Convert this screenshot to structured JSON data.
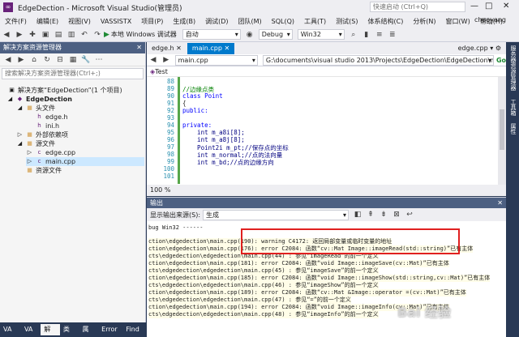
{
  "window": {
    "title": "EdgeDection - Microsoft Visual Studio(管理员)",
    "quick_launch_placeholder": "快速启动 (Ctrl+Q)",
    "user": "chaoyang"
  },
  "menu": [
    "文件(F)",
    "编辑(E)",
    "视图(V)",
    "VASSISTX",
    "项目(P)",
    "生成(B)",
    "调试(D)",
    "团队(M)",
    "SQL(Q)",
    "工具(T)",
    "测试(S)",
    "体系结构(C)",
    "分析(N)",
    "窗口(W)",
    "帮助(H)"
  ],
  "toolbar": {
    "run_label": "本地 Windows 调试器",
    "mode": "自动",
    "config": "Debug",
    "platform": "Win32"
  },
  "solution_explorer": {
    "title": "解决方案资源管理器",
    "search_placeholder": "搜索解决方案资源管理器(Ctrl+;)",
    "items": [
      {
        "label": "解决方案“EdgeDection”(1 个项目)"
      },
      {
        "label": "EdgeDection"
      },
      {
        "label": "头文件"
      },
      {
        "label": "edge.h"
      },
      {
        "label": "ini.h"
      },
      {
        "label": "外部依赖项"
      },
      {
        "label": "源文件"
      },
      {
        "label": "edge.cpp"
      },
      {
        "label": "main.cpp"
      },
      {
        "label": "资源文件"
      }
    ],
    "bottom_tabs": [
      "VA W...",
      "VA V...",
      "解决...",
      "类视图",
      "属性...",
      "Error L...",
      "Find S..."
    ]
  },
  "editor": {
    "tabs": [
      "edge.h",
      "main.cpp"
    ],
    "right_tab": "edge.cpp",
    "file_combo": "main.cpp",
    "path": "G:\\documents\\visual studio 2013\\Projects\\EdgeDection\\EdgeDection\\ma",
    "go_label": "Go",
    "scope": "Test",
    "zoom": "100 %",
    "lines": [
      {
        "n": "88",
        "text": ""
      },
      {
        "n": "89",
        "text": "//边缘点类"
      },
      {
        "n": "90",
        "text": "class Point"
      },
      {
        "n": "91",
        "text": "{"
      },
      {
        "n": "92",
        "text": "public:"
      },
      {
        "n": "93",
        "text": ""
      },
      {
        "n": "94",
        "text": "private:"
      },
      {
        "n": "95",
        "text": "    int m_a8i[8];"
      },
      {
        "n": "96",
        "text": "    int m_a8j[8];"
      },
      {
        "n": "97",
        "text": "    Point2i m_pt;//保存点的坐标"
      },
      {
        "n": "98",
        "text": "    int m_normal;//点的法向量"
      },
      {
        "n": "99",
        "text": "    int m_bd;//点的边缘方向"
      },
      {
        "n": "100",
        "text": ""
      },
      {
        "n": "101",
        "text": ""
      }
    ]
  },
  "output": {
    "title": "输出",
    "source_label": "显示输出来源(S):",
    "source_value": "生成",
    "lines": [
      "bug Win32 ------",
      "ction\\edgedection\\main.cpp(190): warning C4172: 返回局部变量或临时变量的地址",
      "ction\\edgedection\\main.cpp(176): error C2084: 函数“cv::Mat Image::imageRead(std::string)”已有主体",
      "cts\\edgedection\\edgedection\\main.cpp(44) : 参见“imageRead”的前一个定义",
      "ction\\edgedection\\main.cpp(181): error C2084: 函数“void Image::imageSave(cv::Mat)”已有主体",
      "cts\\edgedection\\edgedection\\main.cpp(45) : 参见“imageSave”的前一个定义",
      "ction\\edgedection\\main.cpp(185): error C2084: 函数“void Image::imageShow(std::string,cv::Mat)”已有主体",
      "cts\\edgedection\\edgedection\\main.cpp(46) : 参见“imageShow”的前一个定义",
      "ction\\edgedection\\main.cpp(189): error C2084: 函数“cv::Mat &Image::operator =(cv::Mat)”已有主体",
      "cts\\edgedection\\edgedection\\main.cpp(47) : 参见“=”的前一个定义",
      "ction\\edgedection\\main.cpp(194): error C2084: 函数“void Image::imageInfo(cv::Mat)”已有主体",
      "cts\\edgedection\\edgedection\\main.cpp(48) : 参见“imageInfo”的前一个定义"
    ]
  },
  "right_strip": [
    "服务器资源管理器",
    "工具箱",
    "属性"
  ],
  "watermark": "Bai 经验"
}
